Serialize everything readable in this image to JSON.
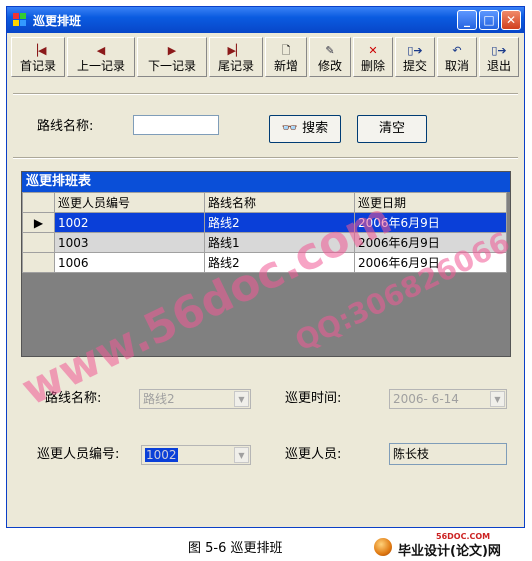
{
  "window": {
    "title": "巡更排班"
  },
  "toolbar": {
    "items": [
      {
        "label": "首记录",
        "icon": "first-record-icon"
      },
      {
        "label": "上一记录",
        "icon": "prev-record-icon"
      },
      {
        "label": "下一记录",
        "icon": "next-record-icon"
      },
      {
        "label": "尾记录",
        "icon": "last-record-icon"
      },
      {
        "label": "新增",
        "icon": "new-document-icon"
      },
      {
        "label": "修改",
        "icon": "edit-icon"
      },
      {
        "label": "删除",
        "icon": "delete-icon"
      },
      {
        "label": "提交",
        "icon": "submit-icon"
      },
      {
        "label": "取消",
        "icon": "undo-icon"
      },
      {
        "label": "退出",
        "icon": "exit-icon"
      }
    ]
  },
  "search": {
    "label": "路线名称:",
    "value": "",
    "search_button": "搜索",
    "clear_button": "清空"
  },
  "grid": {
    "caption": "巡更排班表",
    "columns": [
      "巡更人员编号",
      "路线名称",
      "巡更日期"
    ],
    "rows": [
      {
        "id": "1002",
        "route": "路线2",
        "date": "2006年6月9日",
        "selected": true
      },
      {
        "id": "1003",
        "route": "路线1",
        "date": "2006年6月9日"
      },
      {
        "id": "1006",
        "route": "路线2",
        "date": "2006年6月9日"
      }
    ]
  },
  "detail": {
    "route_label": "路线名称:",
    "route_value": "路线2",
    "time_label": "巡更时间:",
    "time_value": "2006- 6-14",
    "staff_id_label": "巡更人员编号:",
    "staff_id_value": "1002",
    "staff_label": "巡更人员:",
    "staff_value": "陈长枝"
  },
  "figure_caption": "图 5-6 巡更排班",
  "watermarks": {
    "site": "www.56doc.com",
    "qq": "QQ:306826066",
    "logo_small": "56DOC.COM",
    "logo_text": "毕业设计(论文)网"
  }
}
